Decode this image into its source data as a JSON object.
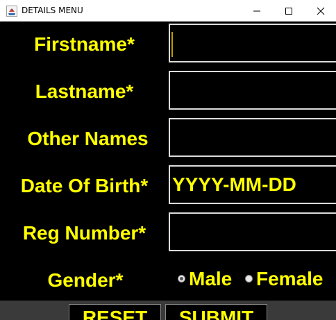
{
  "window": {
    "title": "DETAILS MENU",
    "app_icon": "java-cup-icon",
    "controls": {
      "minimize": "minimize-icon",
      "maximize": "maximize-icon",
      "close": "close-icon"
    }
  },
  "colors": {
    "background": "#000000",
    "text": "#ffff00",
    "field_border": "#dcdcdc",
    "footer": "#3a3a3a",
    "titlebar": "#ffffff"
  },
  "form": {
    "firstname_label": "Firstname*",
    "firstname_value": "",
    "lastname_label": "Lastname*",
    "lastname_value": "",
    "othernames_label": "Other Names",
    "othernames_value": "",
    "dob_label": "Date Of Birth*",
    "dob_value": "YYYY-MM-DD",
    "regnumber_label": "Reg Number*",
    "regnumber_value": "",
    "gender_label": "Gender*",
    "gender_options": [
      "Male",
      "Female"
    ],
    "gender_selected": "Male"
  },
  "buttons": {
    "reset_label": "RESET",
    "submit_label": "SUBMIT"
  }
}
